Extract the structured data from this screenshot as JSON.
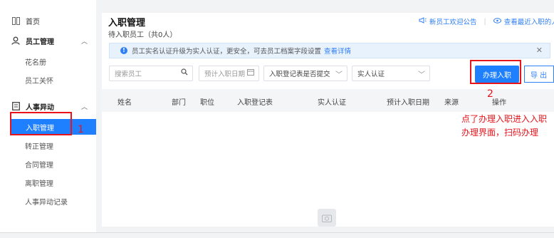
{
  "sidebar": {
    "home": "首页",
    "employee_mgmt": "员工管理",
    "roster": "花名册",
    "relations": "员工关怀",
    "hr_change": "人事异动",
    "onboarding_mgmt": "入职管理",
    "regularization_mgmt": "转正管理",
    "contract_mgmt": "合同管理",
    "resign_mgmt": "离职管理",
    "change_records": "人事异动记录"
  },
  "main": {
    "title": "入职管理",
    "subtitle": "待入职员工（共0人）",
    "link_welcome": "新员工欢迎公告",
    "link_recent": "查看最近入职的人"
  },
  "notice": {
    "text": "员工实名认证升级为实人认证，更安全，可去员工档案字段设置",
    "link": "查看详情"
  },
  "filters": {
    "search_placeholder": "搜索员工",
    "date_placeholder": "预计入职日期",
    "form_status": "入职登记表是否提交",
    "verify": "实人认证"
  },
  "buttons": {
    "onboard": "办理入职",
    "export": "导 出"
  },
  "table": {
    "headers": [
      "姓名",
      "部门",
      "职位",
      "入职登记表",
      "实人认证",
      "预计入职日期",
      "来源",
      "操作"
    ]
  },
  "annotations": {
    "num1": "1",
    "num2": "2",
    "note": "点了办理入职进入入职办理界面，扫码办理"
  }
}
